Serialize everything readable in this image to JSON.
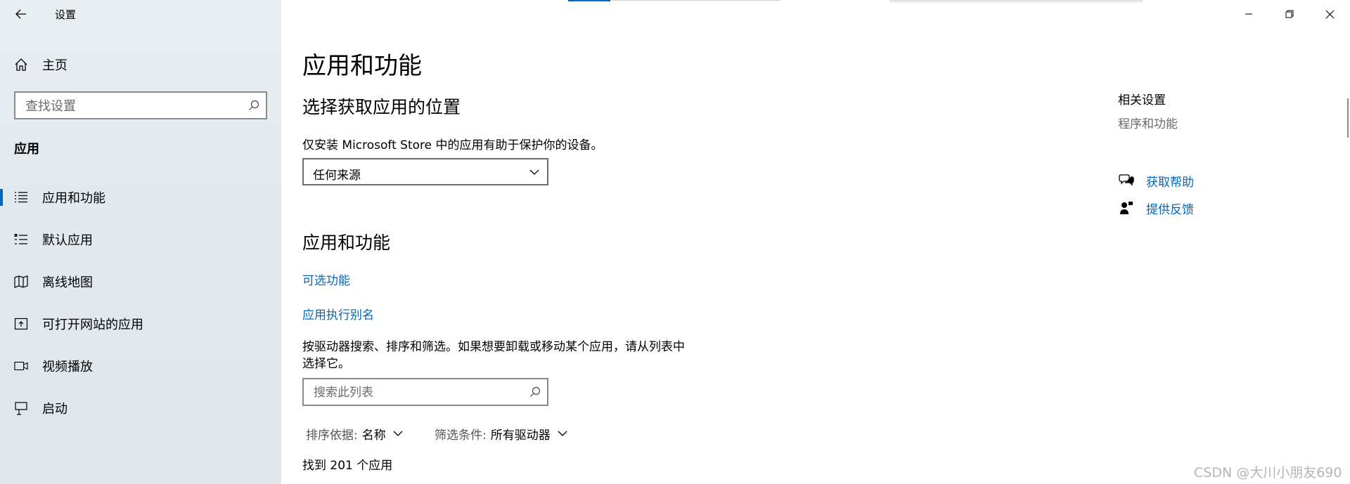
{
  "window": {
    "title": "设置",
    "controls": {
      "minimize": "minimize",
      "restore": "restore",
      "close": "close"
    }
  },
  "sidebar": {
    "home_label": "主页",
    "search_placeholder": "查找设置",
    "section_title": "应用",
    "items": [
      {
        "label": "应用和功能",
        "icon": "apps-features-icon",
        "active": true
      },
      {
        "label": "默认应用",
        "icon": "default-apps-icon",
        "active": false
      },
      {
        "label": "离线地图",
        "icon": "offline-maps-icon",
        "active": false
      },
      {
        "label": "可打开网站的应用",
        "icon": "apps-for-websites-icon",
        "active": false
      },
      {
        "label": "视频播放",
        "icon": "video-playback-icon",
        "active": false
      },
      {
        "label": "启动",
        "icon": "startup-icon",
        "active": false
      }
    ]
  },
  "main": {
    "page_title": "应用和功能",
    "install_section": {
      "heading": "选择获取应用的位置",
      "description": "仅安装 Microsoft Store 中的应用有助于保护你的设备。",
      "source_value": "任何来源"
    },
    "apps_section": {
      "heading": "应用和功能",
      "optional_features_link": "可选功能",
      "app_alias_link": "应用执行别名",
      "description_line1": "按驱动器搜索、排序和筛选。如果想要卸载或移动某个应用，请从列表中",
      "description_line2": "选择它。",
      "search_placeholder": "搜索此列表",
      "sort_label": "排序依据:",
      "sort_value": "名称",
      "filter_label": "筛选条件:",
      "filter_value": "所有驱动器",
      "result_count": "找到 201 个应用"
    }
  },
  "related": {
    "heading": "相关设置",
    "programs_link": "程序和功能",
    "help_link": "获取帮助",
    "feedback_link": "提供反馈"
  },
  "watermark": "CSDN @大川小朋友690",
  "colors": {
    "accent": "#0067c0",
    "sidebar_bg": "#e5ecf0",
    "muted_text": "#6b6b6b"
  }
}
